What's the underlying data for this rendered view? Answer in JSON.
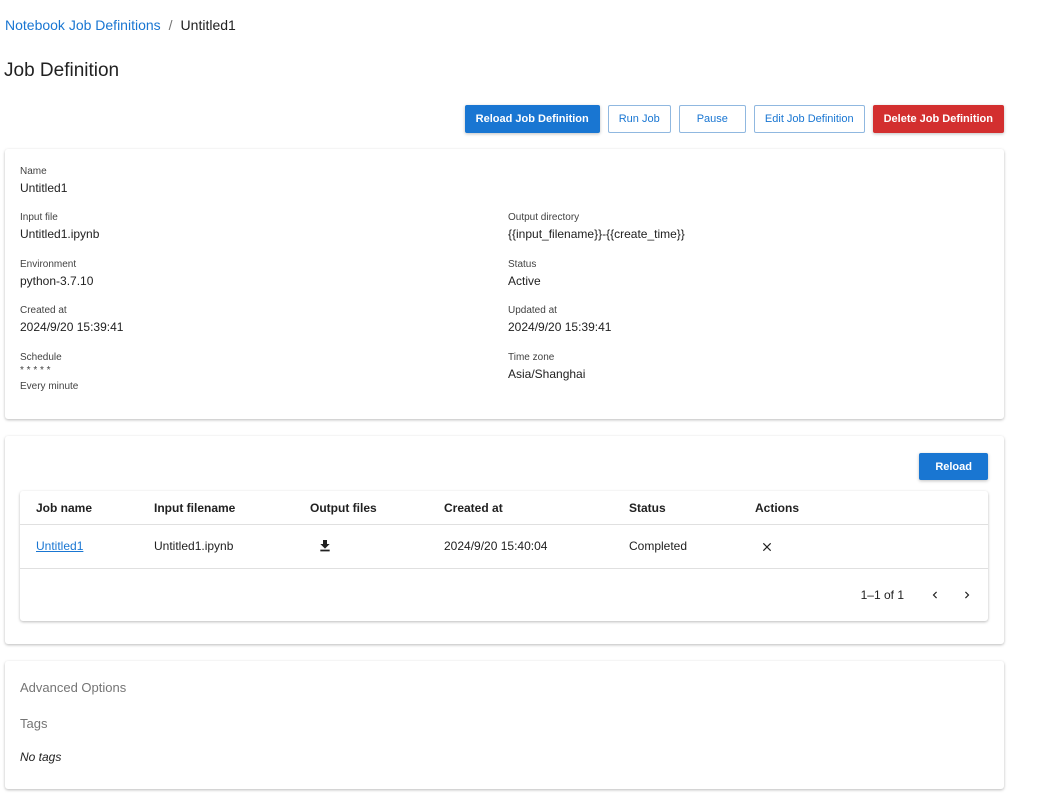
{
  "breadcrumb": {
    "root": "Notebook Job Definitions",
    "separator": "/",
    "current": "Untitled1"
  },
  "page_title": "Job Definition",
  "toolbar": {
    "reload_label": "Reload Job Definition",
    "run_label": "Run Job",
    "pause_label": "Pause",
    "edit_label": "Edit Job Definition",
    "delete_label": "Delete Job Definition"
  },
  "details": {
    "name": {
      "label": "Name",
      "value": "Untitled1"
    },
    "input_file": {
      "label": "Input file",
      "value": "Untitled1.ipynb"
    },
    "output_directory": {
      "label": "Output directory",
      "value": "{{input_filename}}-{{create_time}}"
    },
    "environment": {
      "label": "Environment",
      "value": "python-3.7.10"
    },
    "status": {
      "label": "Status",
      "value": "Active"
    },
    "created_at": {
      "label": "Created at",
      "value": "2024/9/20 15:39:41"
    },
    "updated_at": {
      "label": "Updated at",
      "value": "2024/9/20 15:39:41"
    },
    "schedule": {
      "label": "Schedule",
      "value": "* * * * *",
      "description": "Every minute"
    },
    "time_zone": {
      "label": "Time zone",
      "value": "Asia/Shanghai"
    }
  },
  "jobs": {
    "reload_label": "Reload",
    "columns": [
      "Job name",
      "Input filename",
      "Output files",
      "Created at",
      "Status",
      "Actions"
    ],
    "rows": [
      {
        "job_name": "Untitled1",
        "input_filename": "Untitled1.ipynb",
        "output_files_icon": "download-icon",
        "created_at": "2024/9/20 15:40:04",
        "status": "Completed",
        "action_icon": "close-icon"
      }
    ],
    "pagination": {
      "range": "1–1 of 1"
    }
  },
  "advanced": {
    "title": "Advanced Options",
    "tags_title": "Tags",
    "no_tags": "No tags"
  },
  "colors": {
    "primary": "#1976d2",
    "danger": "#d32f2f"
  }
}
